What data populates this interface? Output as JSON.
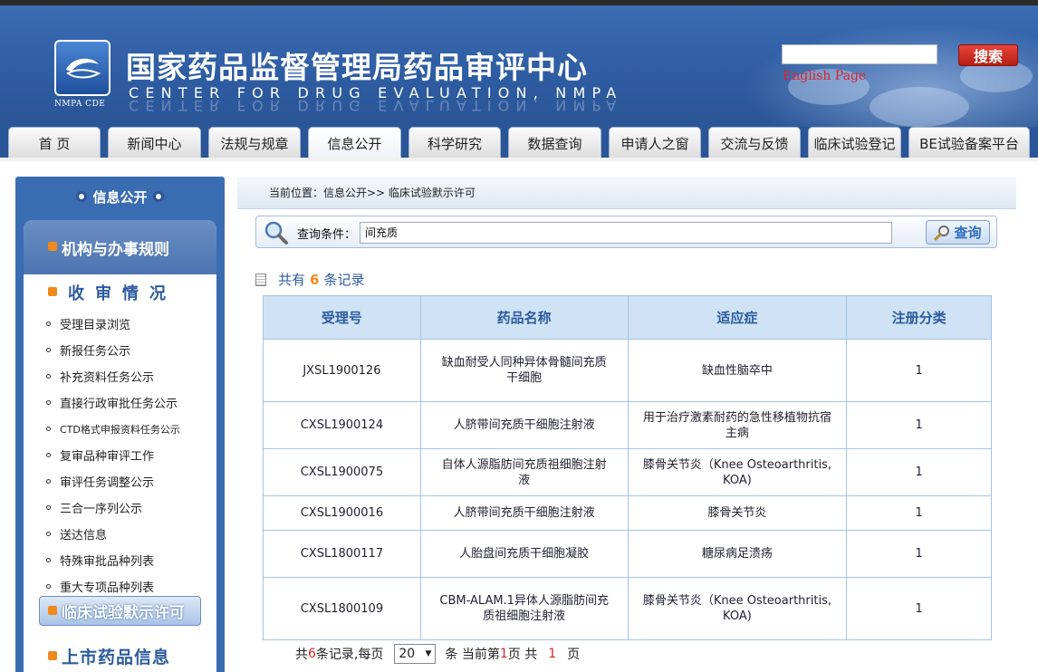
{
  "header": {
    "title_cn": "国家药品监督管理局药品审评中心",
    "title_en": "CENTER FOR DRUG EVALUATION, NMPA",
    "logo_text": "NMPA CDE",
    "search_value": "",
    "search_button": "搜索",
    "english_link": "English Page"
  },
  "nav": {
    "tabs": [
      "首 页",
      "新闻中心",
      "法规与规章",
      "信息公开",
      "科学研究",
      "数据查询",
      "申请人之窗",
      "交流与反馈",
      "临床试验登记",
      "BE试验备案平台"
    ],
    "active": "信息公开"
  },
  "sidebar": {
    "header": "信息公开",
    "sections": [
      {
        "title": "机构与办事规则"
      },
      {
        "title": "收审情况"
      }
    ],
    "items": [
      "受理目录浏览",
      "新报任务公示",
      "补充资料任务公示",
      "直接行政审批任务公示",
      "CTD格式申报资料任务公示",
      "复审品种审评工作",
      "审评任务调整公示",
      "三合一序列公示",
      "送达信息",
      "特殊审批品种列表",
      "重大专项品种列表"
    ],
    "active_item": "临床试验默示许可",
    "bottom_section": "上市药品信息"
  },
  "content": {
    "breadcrumb": "当前位置：信息公开>> 临床试验默示许可",
    "query_label": "查询条件：",
    "query_value": "间充质",
    "query_button": "查询",
    "count_prefix": "共有",
    "count_value": "6",
    "count_suffix": "条记录",
    "columns": [
      "受理号",
      "药品名称",
      "适应症",
      "注册分类"
    ],
    "rows": [
      {
        "id": "JXSL1900126",
        "name": "缺血耐受人同种异体骨髓间充质干细胞",
        "indication": "缺血性脑卒中",
        "category": "1"
      },
      {
        "id": "CXSL1900124",
        "name": "人脐带间充质干细胞注射液",
        "indication": "用于治疗激素耐药的急性移植物抗宿主病",
        "category": "1"
      },
      {
        "id": "CXSL1900075",
        "name": "自体人源脂肪间充质祖细胞注射液",
        "indication": "膝骨关节炎（Knee Osteoarthritis, KOA)",
        "category": "1"
      },
      {
        "id": "CXSL1900016",
        "name": "人脐带间充质干细胞注射液",
        "indication": "膝骨关节炎",
        "category": "1"
      },
      {
        "id": "CXSL1800117",
        "name": "人胎盘间充质干细胞凝胶",
        "indication": "糖尿病足溃疡",
        "category": "1"
      },
      {
        "id": "CXSL1800109",
        "name": "CBM-ALAM.1异体人源脂肪间充质祖细胞注射液",
        "indication": "膝骨关节炎（Knee Osteoarthritis, KOA)",
        "category": "1"
      }
    ],
    "pager": {
      "text1": "共",
      "total": "6",
      "text2": "条记录,每页",
      "per_page": "20",
      "text3": "条 当前第",
      "current": "1",
      "text4": "页 共",
      "pages": "1",
      "text5": "页"
    }
  }
}
